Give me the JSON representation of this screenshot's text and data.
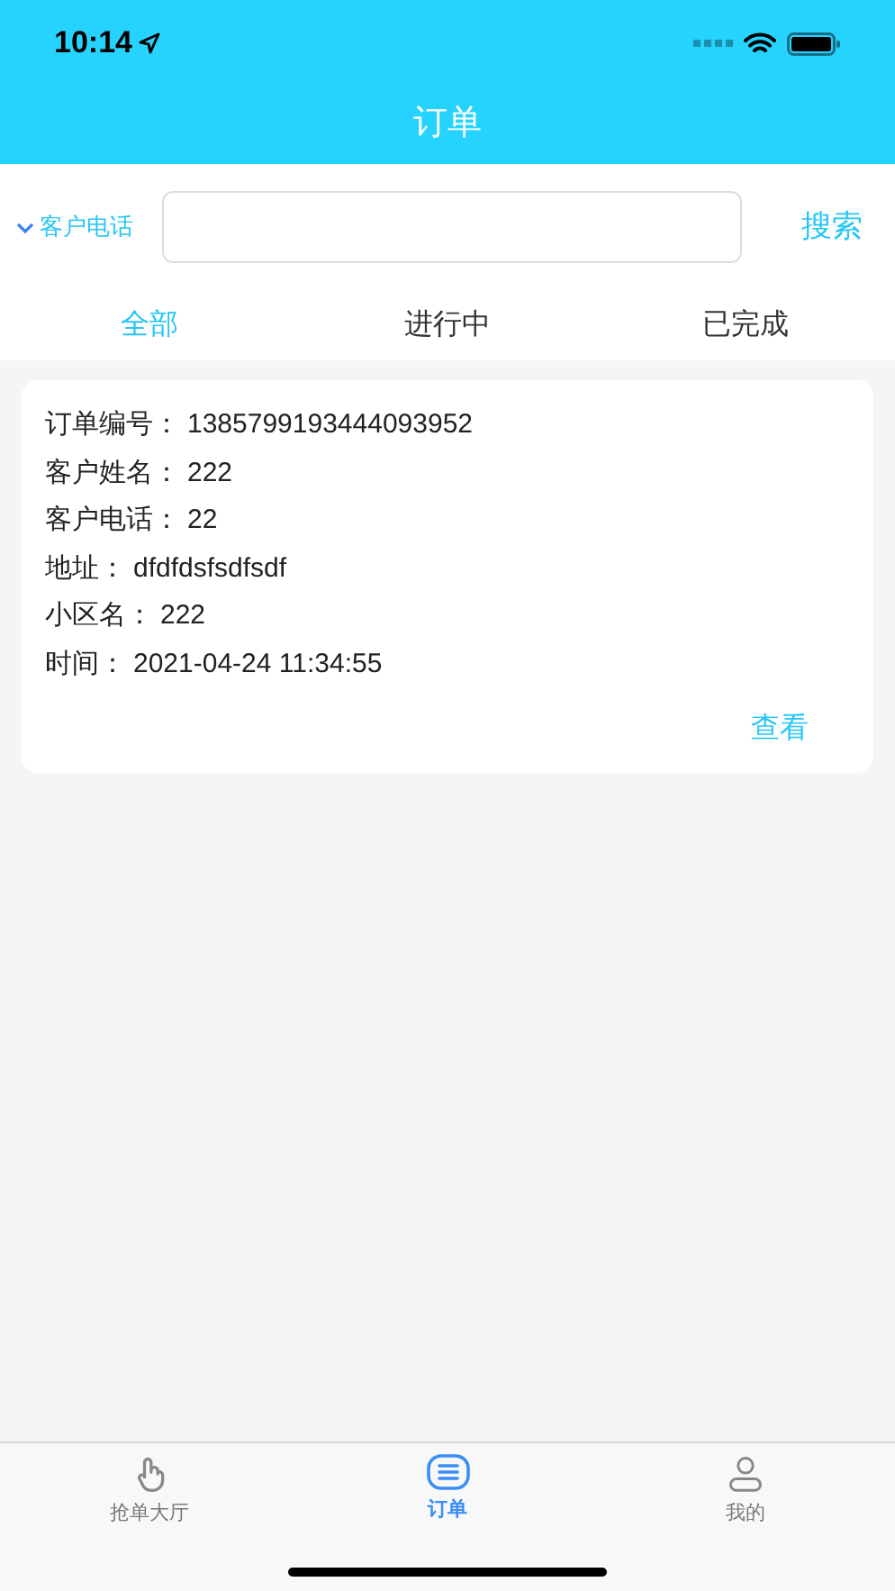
{
  "status_bar": {
    "time": "10:14"
  },
  "header": {
    "title": "订单"
  },
  "search": {
    "filter_label": "客户电话",
    "button": "搜索"
  },
  "tabs": [
    {
      "label": "全部",
      "selected": true
    },
    {
      "label": "进行中",
      "selected": false
    },
    {
      "label": "已完成",
      "selected": false
    }
  ],
  "orders": [
    {
      "fields": [
        {
          "label": "订单编号：",
          "value": "1385799193444093952"
        },
        {
          "label": "客户姓名：",
          "value": "222"
        },
        {
          "label": "客户电话：",
          "value": "22"
        },
        {
          "label": "地址：",
          "value": "dfdfdsfsdfsdf"
        },
        {
          "label": "小区名：",
          "value": "222"
        },
        {
          "label": "时间：",
          "value": "2021-04-24 11:34:55"
        }
      ],
      "action": "查看"
    }
  ],
  "tab_bar": [
    {
      "label": "抢单大厅",
      "selected": false
    },
    {
      "label": "订单",
      "selected": true
    },
    {
      "label": "我的",
      "selected": false
    }
  ]
}
